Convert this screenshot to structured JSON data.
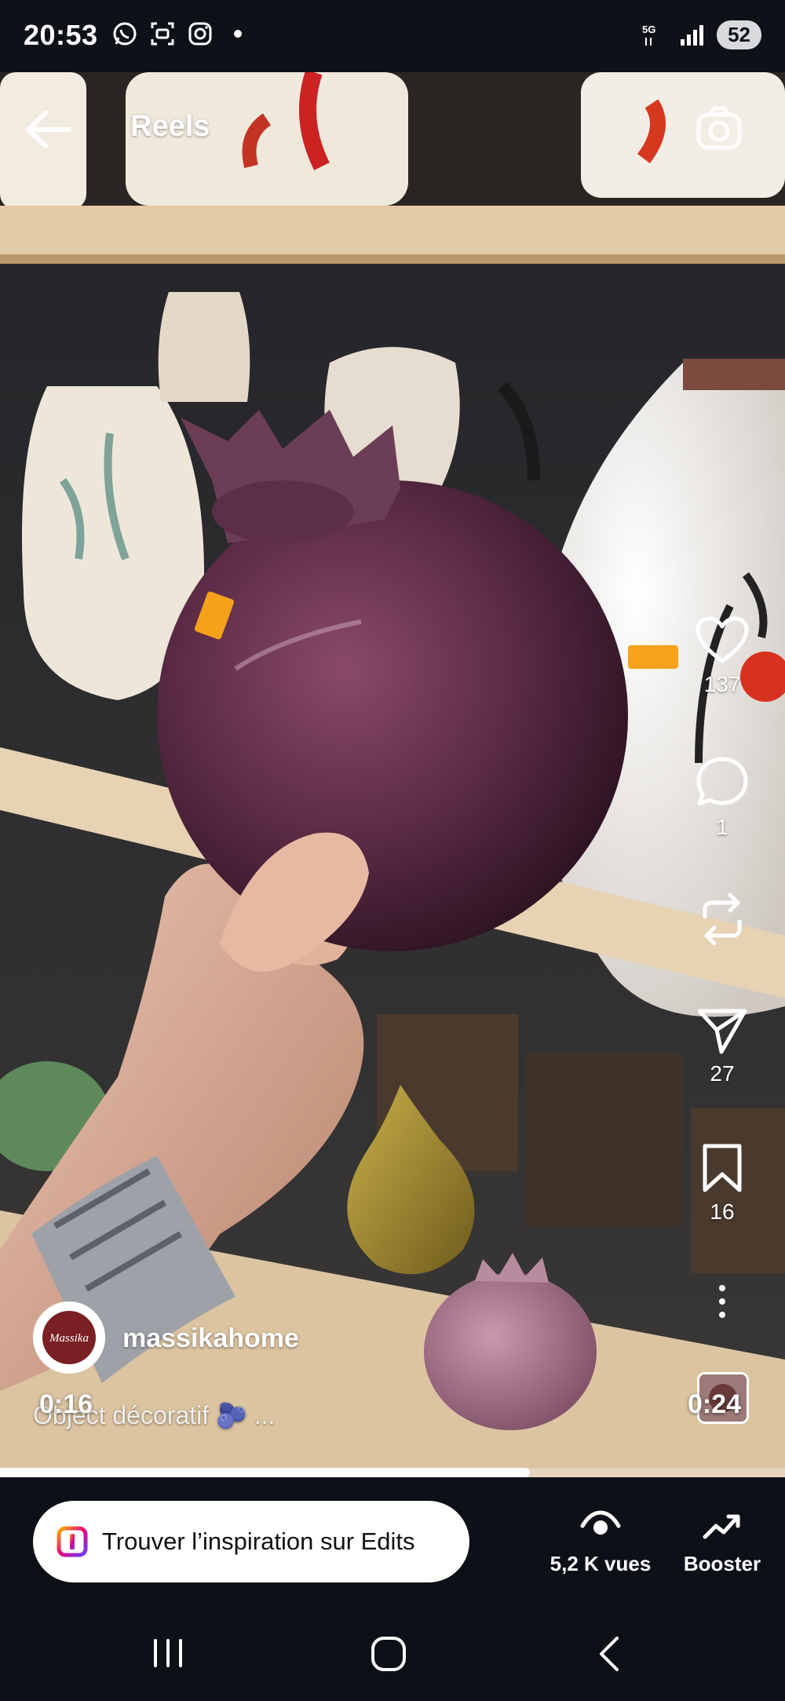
{
  "status_bar": {
    "time": "20:53",
    "battery": "52",
    "network": "5G",
    "icons": [
      "whatsapp-icon",
      "scan-icon",
      "instagram-icon",
      "notification-dot",
      "signal-icon"
    ]
  },
  "topbar": {
    "title": "Reels",
    "back_icon": "arrow-left-icon",
    "camera_icon": "camera-icon"
  },
  "actions": {
    "likes": "137",
    "comments": "1",
    "reposts": "",
    "shares": "27",
    "saves": "16"
  },
  "author": {
    "username": "massikahome",
    "avatar_text": "Massika"
  },
  "caption": "Object décoratif 🫐 ...",
  "playback": {
    "elapsed": "0:16",
    "duration": "0:24",
    "progress": 0.675
  },
  "bottom_bar": {
    "edits_label": "Trouver l’inspiration sur Edits",
    "views_label": "5,2 K vues",
    "boost_label": "Booster"
  },
  "colors": {
    "background": "#0d1117",
    "progress": "#ffffff",
    "edits_gradient": [
      "#f5b400",
      "#e6007e",
      "#6a3cff"
    ]
  }
}
